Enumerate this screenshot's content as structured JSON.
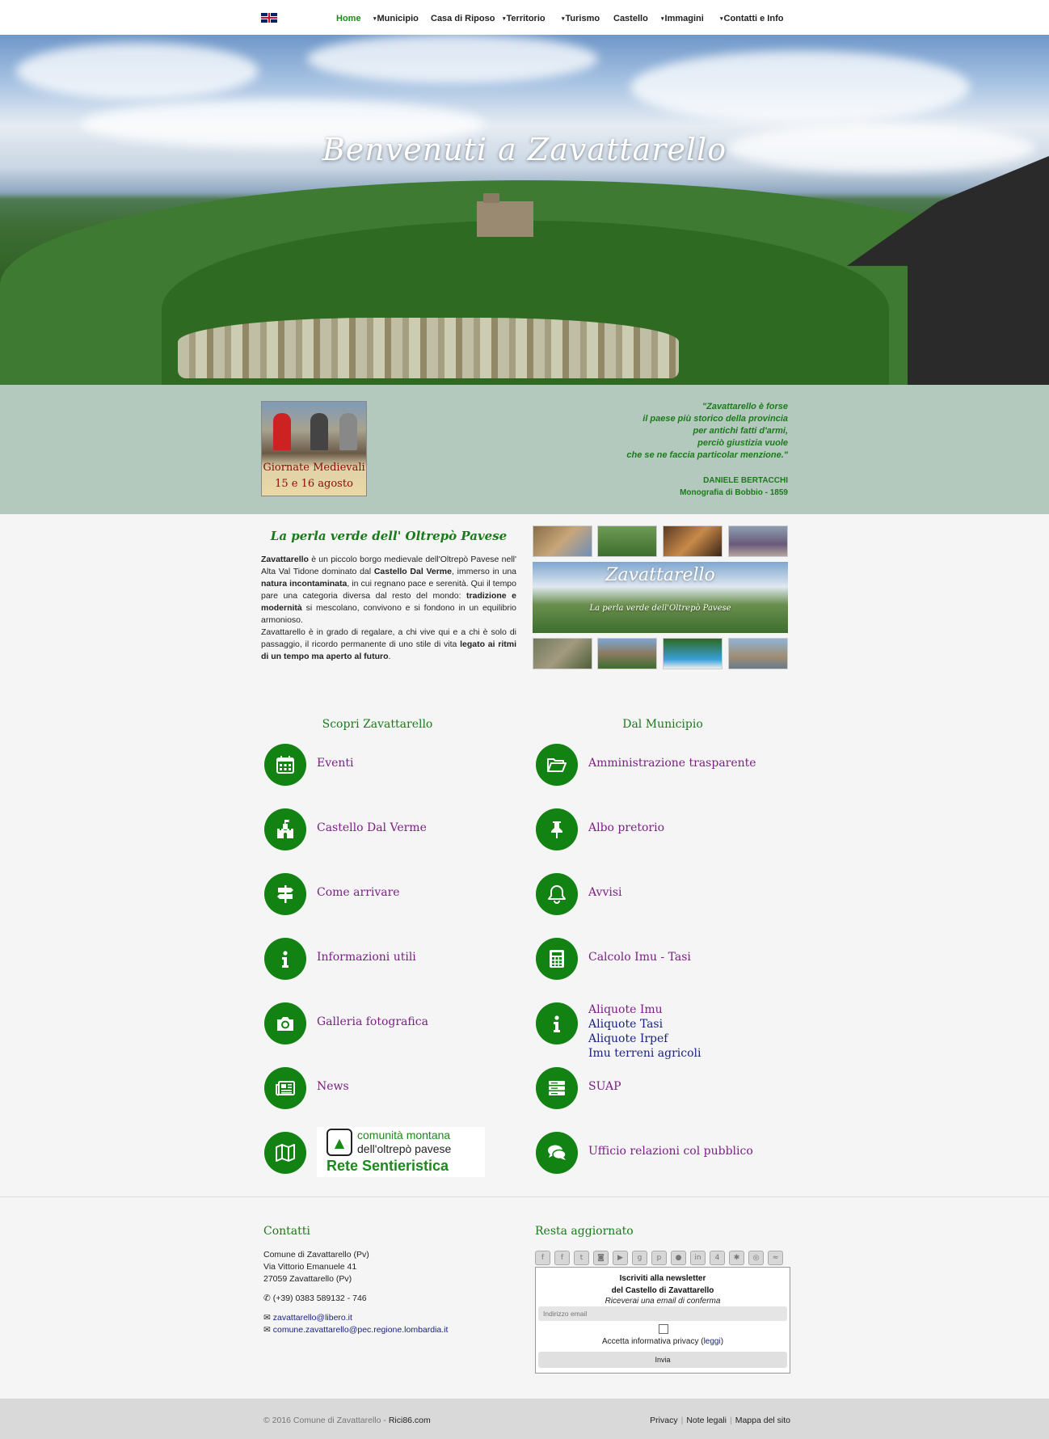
{
  "nav": {
    "items": [
      {
        "label": "Home",
        "dropdown": false,
        "active": true
      },
      {
        "label": "Municipio",
        "dropdown": true
      },
      {
        "label": "Casa di Riposo",
        "dropdown": false
      },
      {
        "label": "Territorio",
        "dropdown": true
      },
      {
        "label": "Turismo",
        "dropdown": true
      },
      {
        "label": "Castello",
        "dropdown": false
      },
      {
        "label": "Immagini",
        "dropdown": true
      },
      {
        "label": "Contatti e Info",
        "dropdown": true
      }
    ],
    "caret": "▾",
    "language_icon": "uk-flag-icon"
  },
  "hero": {
    "title": "Benvenuti a Zavattarello"
  },
  "band": {
    "promo": {
      "line1": "Giornate Medievali",
      "line2": "15 e 16 agosto"
    },
    "quote": [
      "\"Zavattarello è forse",
      "il paese più storico della provincia",
      "per antichi fatti d'armi,",
      "perciò giustizia vuole",
      "che se ne faccia particolar menzione.\""
    ],
    "author": "DANIELE BERTACCHI",
    "source": "Monografia di Bobbio - 1859"
  },
  "intro": {
    "title": "La perla verde dell' Oltrepò Pavese",
    "p1": {
      "a": "Zavattarello",
      "b": " è un piccolo borgo medievale dell'Oltrepò Pavese nell' Alta Val Tidone dominato dal ",
      "c": "Castello Dal Verme",
      "d": ", immerso in una ",
      "e": "natura incontaminata",
      "f": ", in cui regnano pace e serenità. Qui il tempo pare una categoria diversa dal resto del mondo: ",
      "g": "tradizione e modernità",
      "h": " si mescolano, convivono e si fondono in un equilibrio armonioso."
    },
    "p2": {
      "a": "Zavattarello è in grado di regalare, a chi vive qui e a chi è solo di passaggio, il ricordo permanente di uno stile di vita ",
      "b": "legato ai ritmi di un tempo ma aperto al futuro",
      "c": "."
    },
    "gallery_title": "Zavattarello",
    "gallery_sub": "La perla verde dell'Oltrepò Pavese"
  },
  "scopri": {
    "title": "Scopri Zavattarello",
    "items": [
      {
        "label": "Eventi",
        "icon": "calendar-icon"
      },
      {
        "label": "Castello Dal Verme",
        "icon": "castle-icon"
      },
      {
        "label": "Come arrivare",
        "icon": "signpost-icon"
      },
      {
        "label": "Informazioni utili",
        "icon": "info-icon"
      },
      {
        "label": "Galleria fotografica",
        "icon": "camera-icon"
      },
      {
        "label": "News",
        "icon": "newspaper-icon"
      },
      {
        "label": "",
        "icon": "map-icon"
      }
    ],
    "cm_logo": {
      "line1": "comunità montana",
      "line2": "dell'oltrepò pavese",
      "line3": "Rete Sentieristica"
    }
  },
  "municipio": {
    "title": "Dal Municipio",
    "items": [
      {
        "label": "Amministrazione trasparente",
        "icon": "folder-open-icon"
      },
      {
        "label": "Albo pretorio",
        "icon": "pushpin-icon"
      },
      {
        "label": "Avvisi",
        "icon": "bell-icon"
      },
      {
        "label": "Calcolo Imu - Tasi",
        "icon": "calculator-icon"
      },
      {
        "label": "",
        "icon": "info-icon"
      },
      {
        "label": "SUAP",
        "icon": "server-icon"
      },
      {
        "label": "Ufficio relazioni col pubblico",
        "icon": "comments-icon"
      }
    ],
    "aliquote": [
      "Aliquote Imu",
      "Aliquote Tasi",
      "Aliquote Irpef",
      "Imu terreni agricoli"
    ]
  },
  "footer": {
    "contatti_title": "Contatti",
    "address": [
      "Comune di Zavattarello (Pv)",
      "Via Vittorio Emanuele 41",
      "27059 Zavattarello (Pv)"
    ],
    "phone": "(+39) 0383 589132 - 746",
    "email": "zavattarello@libero.it",
    "pec": "comune.zavattarello@pec.regione.lombardia.it",
    "resta_title": "Resta aggiornato",
    "socials": [
      "facebook-icon",
      "facebook-icon",
      "twitter-icon",
      "instagram-icon",
      "youtube-icon",
      "google-plus-icon",
      "pinterest-icon",
      "flickr-icon",
      "linkedin-icon",
      "foursquare-icon",
      "yelp-icon",
      "tripadvisor-icon",
      "rss-icon"
    ],
    "newsletter": {
      "title1": "Iscriviti alla newsletter",
      "title2": "del Castello di Zavattarello",
      "subtitle": "Riceverai una email di conferma",
      "placeholder": "Indirizzo email",
      "privacy": "Accetta informativa privacy (",
      "privacy_link": "leggi",
      "privacy_end": ")",
      "button": "Invia"
    }
  },
  "bottom": {
    "copyright": "© 2016 Comune di Zavattarello - ",
    "brand": "Rici86.com",
    "links": [
      "Privacy",
      "Note legali",
      "Mappa del sito"
    ]
  },
  "colors": {
    "green": "#128212",
    "purple_link": "#7b1f86",
    "band": "#b4c9bd"
  }
}
